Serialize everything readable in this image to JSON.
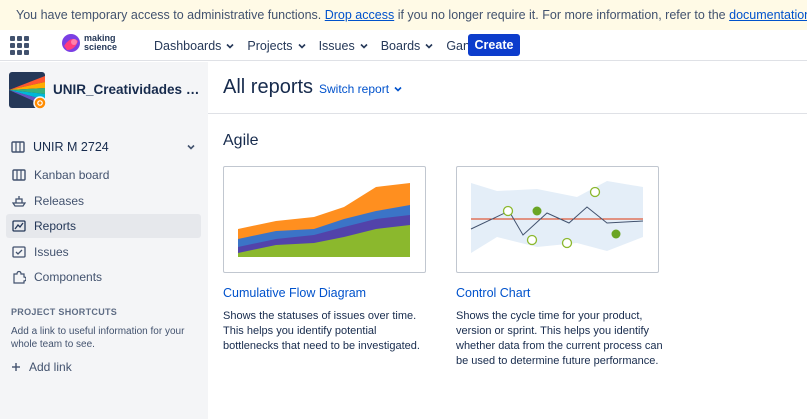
{
  "banner": {
    "text_before": "You have temporary access to administrative functions.",
    "drop_link": "Drop access",
    "text_middle": "if you no longer require it. For more information, refer to the",
    "doc_link": "documentation",
    "text_after": ".",
    "icon": "warning-icon"
  },
  "nav": {
    "logo_line1": "making",
    "logo_line2": "science",
    "items": [
      {
        "label": "Dashboards",
        "dropdown": true
      },
      {
        "label": "Projects",
        "dropdown": true
      },
      {
        "label": "Issues",
        "dropdown": true
      },
      {
        "label": "Boards",
        "dropdown": true
      },
      {
        "label": "Gantt",
        "dropdown": false
      }
    ],
    "create_label": "Create",
    "accent": "#0c3ccc"
  },
  "sidebar": {
    "project_name": "UNIR_Creatividades D...",
    "board_selector": "UNIR M 2724",
    "items": [
      {
        "label": "Kanban board",
        "icon": "board-icon"
      },
      {
        "label": "Releases",
        "icon": "ship-icon"
      },
      {
        "label": "Reports",
        "icon": "chart-icon",
        "active": true
      },
      {
        "label": "Issues",
        "icon": "issues-icon"
      },
      {
        "label": "Components",
        "icon": "puzzle-icon"
      }
    ],
    "shortcuts_title": "PROJECT SHORTCUTS",
    "shortcuts_desc": "Add a link to useful information for your whole team to see.",
    "add_link": "Add link"
  },
  "main": {
    "title": "All reports",
    "switch_report": "Switch report",
    "section": "Agile",
    "reports": [
      {
        "title": "Cumulative Flow Diagram",
        "description": "Shows the statuses of issues over time. This helps you identify potential bottlenecks that need to be investigated."
      },
      {
        "title": "Control Chart",
        "description": "Shows the cycle time for your product, version or sprint. This helps you identify whether data from the current process can be used to determine future performance."
      }
    ]
  }
}
